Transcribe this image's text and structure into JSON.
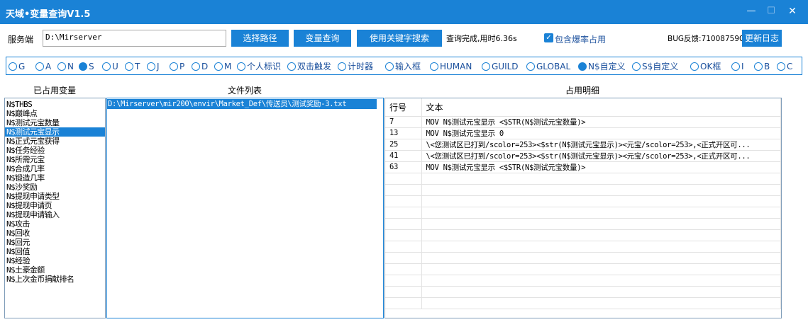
{
  "window": {
    "title": "天域•变量查询V1.5",
    "min": "—",
    "max": "☐",
    "close": "✕"
  },
  "toolbar": {
    "server_label": "服务端",
    "server_path": "D:\\Mirserver",
    "select_path": "选择路径",
    "query_vars": "变量查询",
    "keyword_search": "使用关键字搜索",
    "status": "查询完成,用时6.36s",
    "include_drop_label": "包含爆率占用",
    "bug_feedback": "BUG反馈:710087590",
    "update_log": "更新日志"
  },
  "radios": [
    {
      "label": "G",
      "checked": false
    },
    {
      "label": "A",
      "checked": false
    },
    {
      "label": "N",
      "checked": false
    },
    {
      "label": "S",
      "checked": true
    },
    {
      "label": "U",
      "checked": false
    },
    {
      "label": "T",
      "checked": false
    },
    {
      "label": "J",
      "checked": false
    },
    {
      "label": "P",
      "checked": false
    },
    {
      "label": "D",
      "checked": false
    },
    {
      "label": "M",
      "checked": false
    },
    {
      "label": "个人标识",
      "checked": false
    },
    {
      "label": "双击触发",
      "checked": false
    },
    {
      "label": "计时器",
      "checked": false
    },
    {
      "label": "输入框",
      "checked": false
    },
    {
      "label": "HUMAN",
      "checked": false
    },
    {
      "label": "GUILD",
      "checked": false
    },
    {
      "label": "GLOBAL",
      "checked": false
    },
    {
      "label": "N$自定义",
      "checked": true
    },
    {
      "label": "S$自定义",
      "checked": false
    },
    {
      "label": "OK框",
      "checked": false
    },
    {
      "label": "I",
      "checked": false
    },
    {
      "label": "B",
      "checked": false
    },
    {
      "label": "C",
      "checked": false
    }
  ],
  "sections": {
    "vars": "已占用变量",
    "files": "文件列表",
    "details": "占用明细"
  },
  "variables": [
    "N$THBS",
    "N$巅峰点",
    "N$测试元宝数量",
    "N$测试元宝显示",
    "N$正式元宝获得",
    "N$任务经验",
    "N$所需元宝",
    "N$合成几率",
    "N$锻造几率",
    "N$沙奖励",
    "N$提现申请类型",
    "N$提现申请页",
    "N$提现申请输入",
    "N$攻击",
    "N$回收",
    "N$回元",
    "N$回值",
    "N$经验",
    "N$土豪金额",
    "N$上次金币捐献排名"
  ],
  "selected_variable_index": 3,
  "files": [
    "D:\\Mirserver\\mir200\\envir\\Market_Def\\传送员\\测试奖励-3.txt"
  ],
  "detail_table": {
    "headers": [
      "行号",
      "文本"
    ],
    "rows": [
      {
        "line": "7",
        "text": "MOV N$测试元宝显示 <$STR(N$测试元宝数量)>"
      },
      {
        "line": "13",
        "text": "MOV N$测试元宝显示 0"
      },
      {
        "line": "25",
        "text": "\\<您测试区已打到/scolor=253><$str(N$测试元宝显示)><元宝/scolor=253>,<正式开区可..."
      },
      {
        "line": "41",
        "text": "\\<您测试区已打到/scolor=253><$str(N$测试元宝显示)><元宝/scolor=253>,<正式开区可..."
      },
      {
        "line": "63",
        "text": "MOV N$测试元宝显示 <$STR(N$测试元宝数量)>"
      }
    ]
  }
}
